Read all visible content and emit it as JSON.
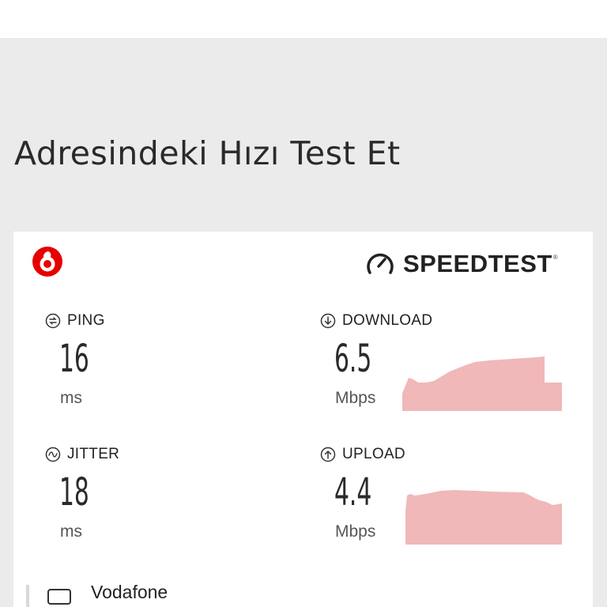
{
  "page": {
    "title": "Adresindeki Hızı Test Et"
  },
  "speedtest": {
    "brand": "SPEEDTEST",
    "brand_mark": "®",
    "ping": {
      "label": "PING",
      "value": "16",
      "unit": "ms"
    },
    "jitter": {
      "label": "JITTER",
      "value": "18",
      "unit": "ms"
    },
    "download": {
      "label": "DOWNLOAD",
      "value": "6.5",
      "unit": "Mbps"
    },
    "upload": {
      "label": "UPLOAD",
      "value": "4.4",
      "unit": "Mbps"
    },
    "isp": {
      "name": "Vodafone"
    }
  },
  "colors": {
    "graph_fill": "#f0b8b8",
    "vodafone_red": "#e60000",
    "background": "#ebebeb"
  },
  "icons": {
    "ping": "ping-icon",
    "jitter": "jitter-icon",
    "download": "download-arrow-icon",
    "upload": "upload-arrow-icon",
    "isp": "network-device-icon"
  }
}
